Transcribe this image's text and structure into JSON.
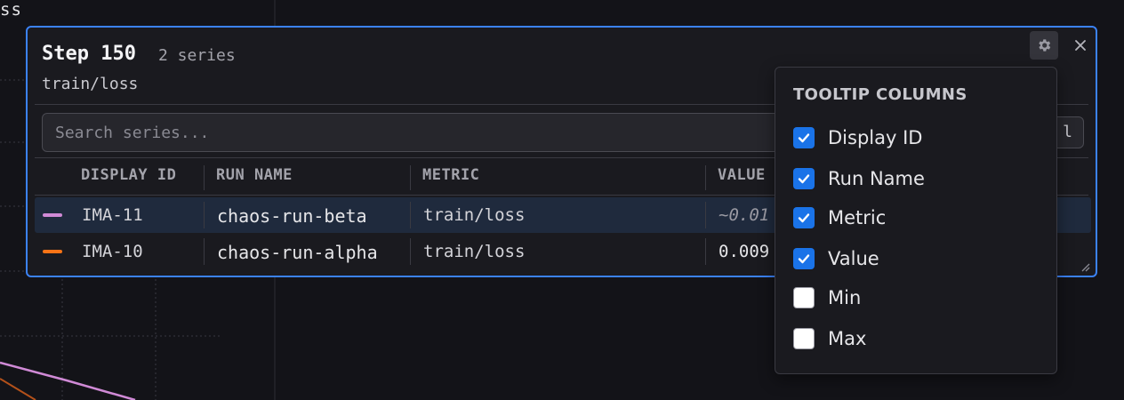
{
  "background": {
    "title_fragment": "ss"
  },
  "tooltip": {
    "step_label": "Step 150",
    "series_count": "2 series",
    "metric": "train/loss",
    "search_placeholder": "Search series...",
    "side_button_fragment": "l",
    "columns": {
      "display_id": "DISPLAY ID",
      "run_name": "RUN NAME",
      "metric": "METRIC",
      "value": "VALUE"
    },
    "rows": [
      {
        "color": "#d08ad6",
        "display_id": "IMA-11",
        "run_name": "chaos-run-beta",
        "metric": "train/loss",
        "value": "~0.01",
        "highlighted": true
      },
      {
        "color": "#f97316",
        "display_id": "IMA-10",
        "run_name": "chaos-run-alpha",
        "metric": "train/loss",
        "value": "0.009",
        "highlighted": false
      }
    ],
    "icons": {
      "settings": "gear-icon",
      "close": "close-icon",
      "resize": "resize-grip-icon"
    }
  },
  "column_picker": {
    "title": "TOOLTIP COLUMNS",
    "options": [
      {
        "label": "Display ID",
        "checked": true
      },
      {
        "label": "Run Name",
        "checked": true
      },
      {
        "label": "Metric",
        "checked": true
      },
      {
        "label": "Value",
        "checked": true
      },
      {
        "label": "Min",
        "checked": false
      },
      {
        "label": "Max",
        "checked": false
      }
    ]
  },
  "colors": {
    "accent": "#3b82f6",
    "checkbox_checked": "#1a73e8",
    "row_highlight": "#1f2a3d"
  }
}
